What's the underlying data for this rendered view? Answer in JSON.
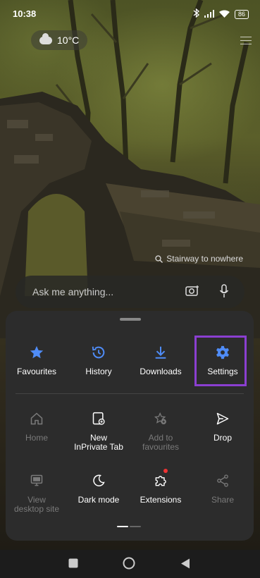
{
  "status": {
    "time": "10:38",
    "battery": "86"
  },
  "weather": {
    "temperature": "10°C"
  },
  "wallpaper": {
    "caption": "Stairway to nowhere"
  },
  "search": {
    "placeholder": "Ask me anything..."
  },
  "menu": {
    "row1": [
      {
        "label": "Favourites",
        "icon": "star-icon",
        "color": "#4f8cf7"
      },
      {
        "label": "History",
        "icon": "history-icon",
        "color": "#4f8cf7"
      },
      {
        "label": "Downloads",
        "icon": "download-icon",
        "color": "#4f8cf7"
      },
      {
        "label": "Settings",
        "icon": "gear-icon",
        "color": "#4f8cf7"
      }
    ],
    "row2": [
      {
        "label": "Home",
        "icon": "home-icon",
        "disabled": true
      },
      {
        "label": "New\nInPrivate Tab",
        "icon": "inprivate-tab-icon",
        "disabled": false
      },
      {
        "label": "Add to\nfavourites",
        "icon": "star-add-icon",
        "disabled": true
      },
      {
        "label": "Drop",
        "icon": "send-icon",
        "disabled": false
      }
    ],
    "row3": [
      {
        "label": "View\ndesktop site",
        "icon": "monitor-icon",
        "disabled": true
      },
      {
        "label": "Dark mode",
        "icon": "moon-icon",
        "disabled": false
      },
      {
        "label": "Extensions",
        "icon": "puzzle-icon",
        "disabled": false
      },
      {
        "label": "Share",
        "icon": "share-icon",
        "disabled": true
      }
    ],
    "highlight_color": "#8b3fd1"
  }
}
